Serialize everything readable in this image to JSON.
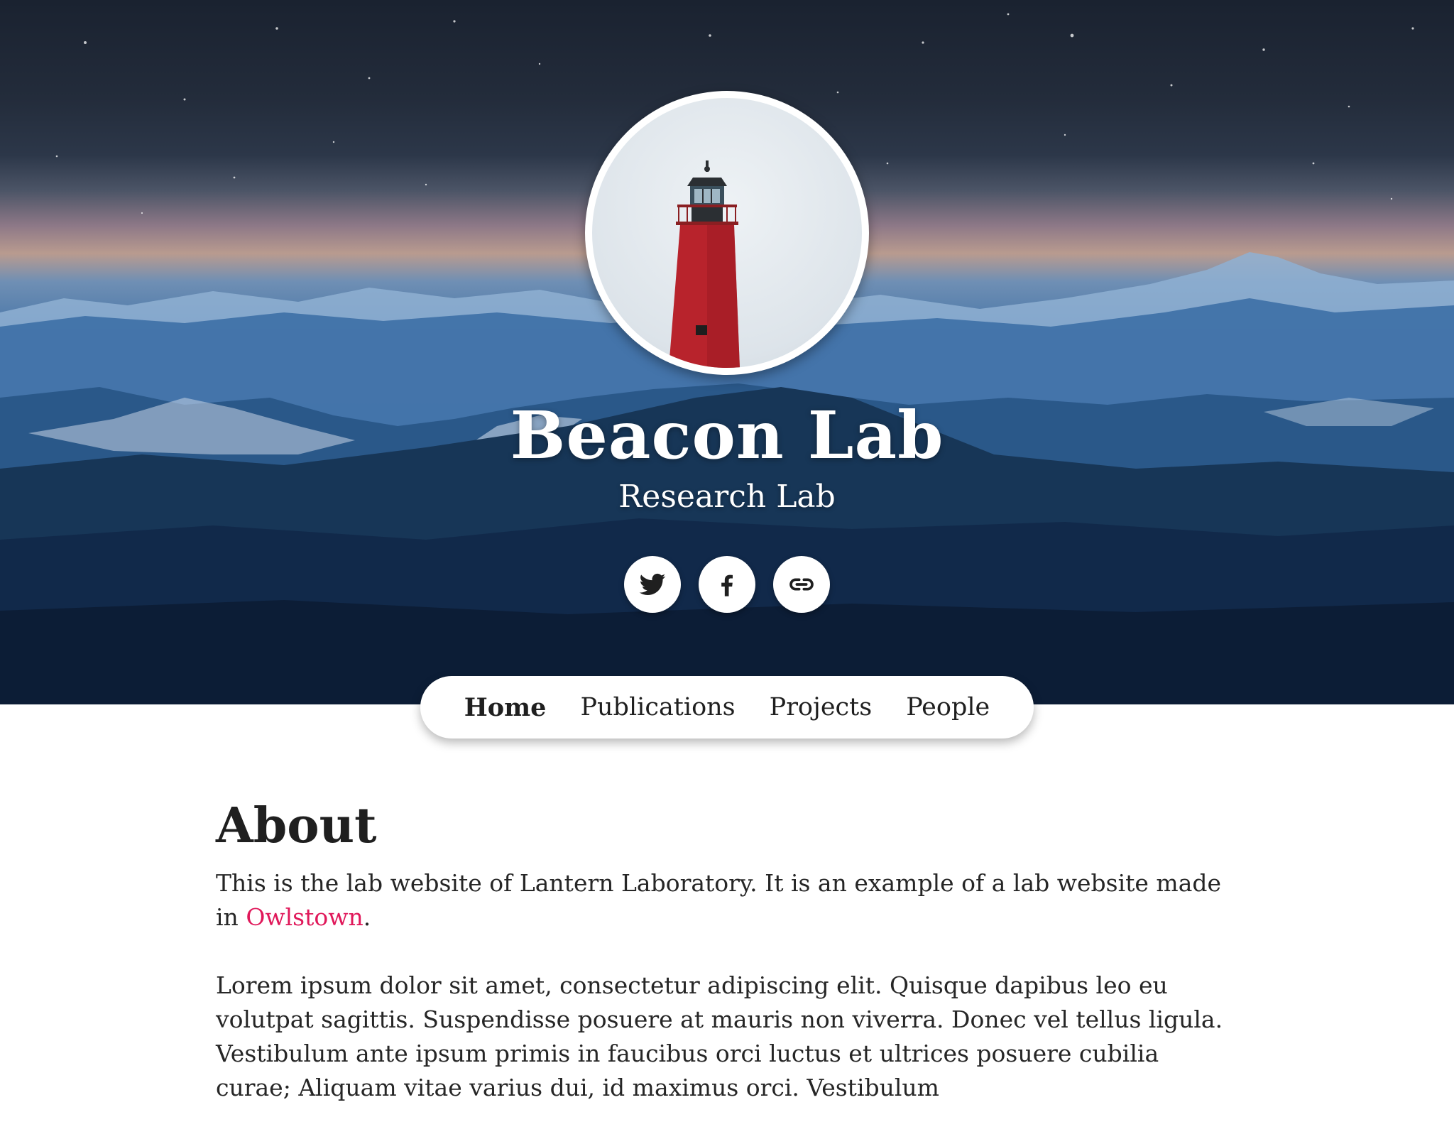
{
  "header": {
    "title": "Beacon Lab",
    "subtitle": "Research Lab",
    "avatar_icon": "lighthouse-icon",
    "social": [
      {
        "name": "twitter",
        "icon": "twitter-icon"
      },
      {
        "name": "facebook",
        "icon": "facebook-icon"
      },
      {
        "name": "website",
        "icon": "link-icon"
      }
    ]
  },
  "nav": {
    "items": [
      {
        "label": "Home",
        "active": true
      },
      {
        "label": "Publications",
        "active": false
      },
      {
        "label": "Projects",
        "active": false
      },
      {
        "label": "People",
        "active": false
      }
    ]
  },
  "about": {
    "heading": "About",
    "intro_before": "This is the lab website of Lantern Laboratory. It is an example of a lab website made in ",
    "intro_link": "Owlstown",
    "intro_after": ".",
    "lorem": "Lorem ipsum dolor sit amet, consectetur adipiscing elit. Quisque dapibus leo eu volutpat sagittis. Suspendisse posuere at mauris non viverra. Donec vel tellus ligula. Vestibulum ante ipsum primis in faucibus orci luctus et ultrices posuere cubilia curae; Aliquam vitae varius dui, id maximus orci. Vestibulum"
  },
  "colors": {
    "link": "#e0185a",
    "lighthouse_red": "#b8232c",
    "text": "#1f1f1f"
  }
}
